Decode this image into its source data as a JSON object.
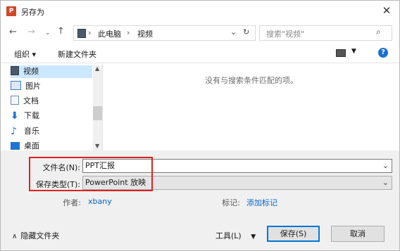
{
  "window": {
    "title": "另存为",
    "app_icon_letter": "P"
  },
  "nav": {
    "breadcrumb": [
      "此电脑",
      "视频"
    ],
    "search_placeholder": "搜索\"视频\""
  },
  "toolbar": {
    "organize": "组织 ▾",
    "new_folder": "新建文件夹"
  },
  "sidebar": {
    "items": [
      {
        "label": "视频",
        "icon": "video-folder-icon",
        "color": "#4a5a6a"
      },
      {
        "label": "图片",
        "icon": "pictures-folder-icon",
        "color": "#3a7bd5"
      },
      {
        "label": "文档",
        "icon": "documents-folder-icon",
        "color": "#6b8fb5"
      },
      {
        "label": "下载",
        "icon": "download-arrow-icon",
        "color": "#1e73d8"
      },
      {
        "label": "音乐",
        "icon": "music-note-icon",
        "color": "#1e73d8"
      },
      {
        "label": "桌面",
        "icon": "desktop-folder-icon",
        "color": "#1e73d8"
      }
    ]
  },
  "main": {
    "empty_message": "没有与搜索条件匹配的项。"
  },
  "form": {
    "filename_label": "文件名(N):",
    "filename_value": "PPT汇报",
    "filetype_label": "保存类型(T):",
    "filetype_value": "PowerPoint 放映",
    "author_label": "作者:",
    "author_value": "xbany",
    "tags_label": "标记:",
    "tags_link": "添加标记"
  },
  "footer": {
    "hide_folders": "隐藏文件夹",
    "tools": "工具(L)",
    "save": "保存(S)",
    "cancel": "取消"
  },
  "colors": {
    "highlight_border": "#e02020",
    "primary_button_border": "#0078d7",
    "link": "#0066cc"
  }
}
